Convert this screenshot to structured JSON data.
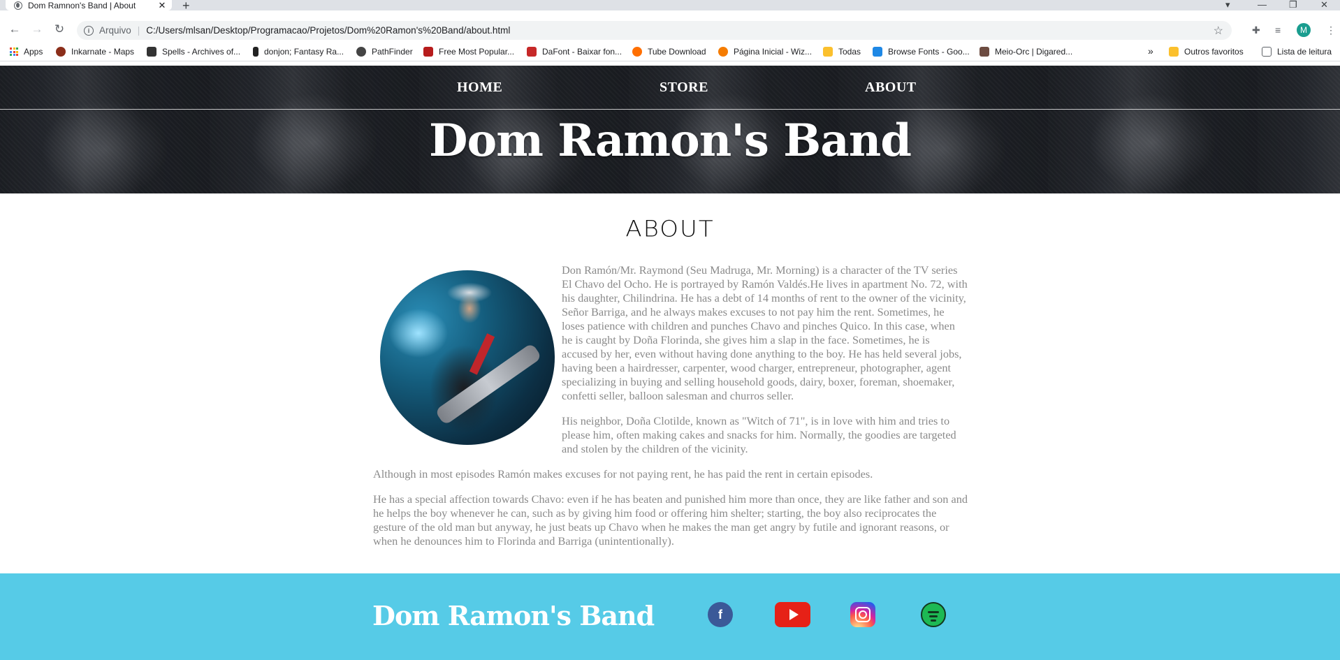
{
  "browser": {
    "tab_title": "Dom Ramnon's Band | About",
    "tab_close": "✕",
    "new_tab": "+",
    "address_scheme": "Arquivo",
    "address_url": "C:/Users/mlsan/Desktop/Programacao/Projetos/Dom%20Ramon's%20Band/about.html",
    "profile_initial": "M",
    "bookmarks": [
      {
        "label": "Apps",
        "color": "#ea4335"
      },
      {
        "label": "Inkarnate - Maps",
        "color": "#8b2e1a"
      },
      {
        "label": "Spells - Archives of...",
        "color": "#333333"
      },
      {
        "label": "donjon; Fantasy Ra...",
        "color": "#222222"
      },
      {
        "label": "PathFinder",
        "color": "#444444"
      },
      {
        "label": "Free Most Popular...",
        "color": "#b71c1c"
      },
      {
        "label": "DaFont - Baixar fon...",
        "color": "#c62828"
      },
      {
        "label": "Tube Download",
        "color": "#ff6f00"
      },
      {
        "label": "Página Inicial - Wiz...",
        "color": "#f57c00"
      },
      {
        "label": "Todas",
        "color": "#fbc02d"
      },
      {
        "label": "Browse Fonts - Goo...",
        "color": "#1e88e5"
      },
      {
        "label": "Meio-Orc | Digared...",
        "color": "#6d4c41"
      }
    ],
    "more_bookmarks": "»",
    "other_bookmarks": "Outros favoritos",
    "reading_list": "Lista de leitura"
  },
  "nav": {
    "items": [
      "HOME",
      "STORE",
      "ABOUT"
    ]
  },
  "hero": {
    "title": "Dom Ramon's Band"
  },
  "about": {
    "heading": "ABOUT",
    "paragraphs": [
      "Don Ramón/Mr. Raymond (Seu Madruga, Mr. Morning) is a character of the TV series El Chavo del Ocho. He is portrayed by Ramón Valdés.He lives in apartment No. 72, with his daughter, Chilindrina. He has a debt of 14 months of rent to the owner of the vicinity, Señor Barriga, and he always makes excuses to not pay him the rent. Sometimes, he loses patience with children and punches Chavo and pinches Quico. In this case, when he is caught by Doña Florinda, she gives him a slap in the face. Sometimes, he is accused by her, even without having done anything to the boy. He has held several jobs, having been a hairdresser, carpenter, wood charger, entrepreneur, photographer, agent specializing in buying and selling household goods, dairy, boxer, foreman, shoemaker, confetti seller, balloon salesman and churros seller.",
      "His neighbor, Doña Clotilde, known as \"Witch of 71\", is in love with him and tries to please him, often making cakes and snacks for him. Normally, the goodies are targeted and stolen by the children of the vicinity.",
      "Although in most episodes Ramón makes excuses for not paying rent, he has paid the rent in certain episodes.",
      "He has a special affection towards Chavo: even if he has beaten and punished him more than once, they are like father and son and he helps the boy whenever he can, such as by giving him food or offering him shelter; starting, the boy also reciprocates the gesture of the old man but anyway, he just beats up Chavo when he makes the man get angry by futile and ignorant reasons, or when he denounces him to Florinda and Barriga (unintentionally)."
    ]
  },
  "footer": {
    "logo": "Dom Ramon's Band",
    "facebook_glyph": "f",
    "accent_color": "#56cbe7"
  }
}
